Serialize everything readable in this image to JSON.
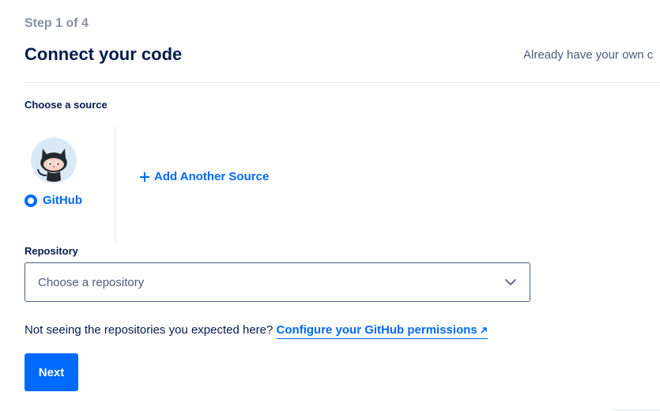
{
  "header": {
    "step": "Step 1 of 4",
    "title": "Connect your code",
    "already_text": "Already have your own c"
  },
  "source": {
    "label": "Choose a source",
    "selected": {
      "name": "GitHub",
      "icon": "github-octocat-icon"
    },
    "add_another": "Add Another Source"
  },
  "repository": {
    "label": "Repository",
    "placeholder": "Choose a repository"
  },
  "help": {
    "text": "Not seeing the repositories you expected here?",
    "link": "Configure your GitHub permissions"
  },
  "actions": {
    "next": "Next"
  },
  "colors": {
    "accent": "#0069ff",
    "heading": "#031b4e",
    "muted": "#8690a2",
    "border": "#4d5b7c"
  }
}
